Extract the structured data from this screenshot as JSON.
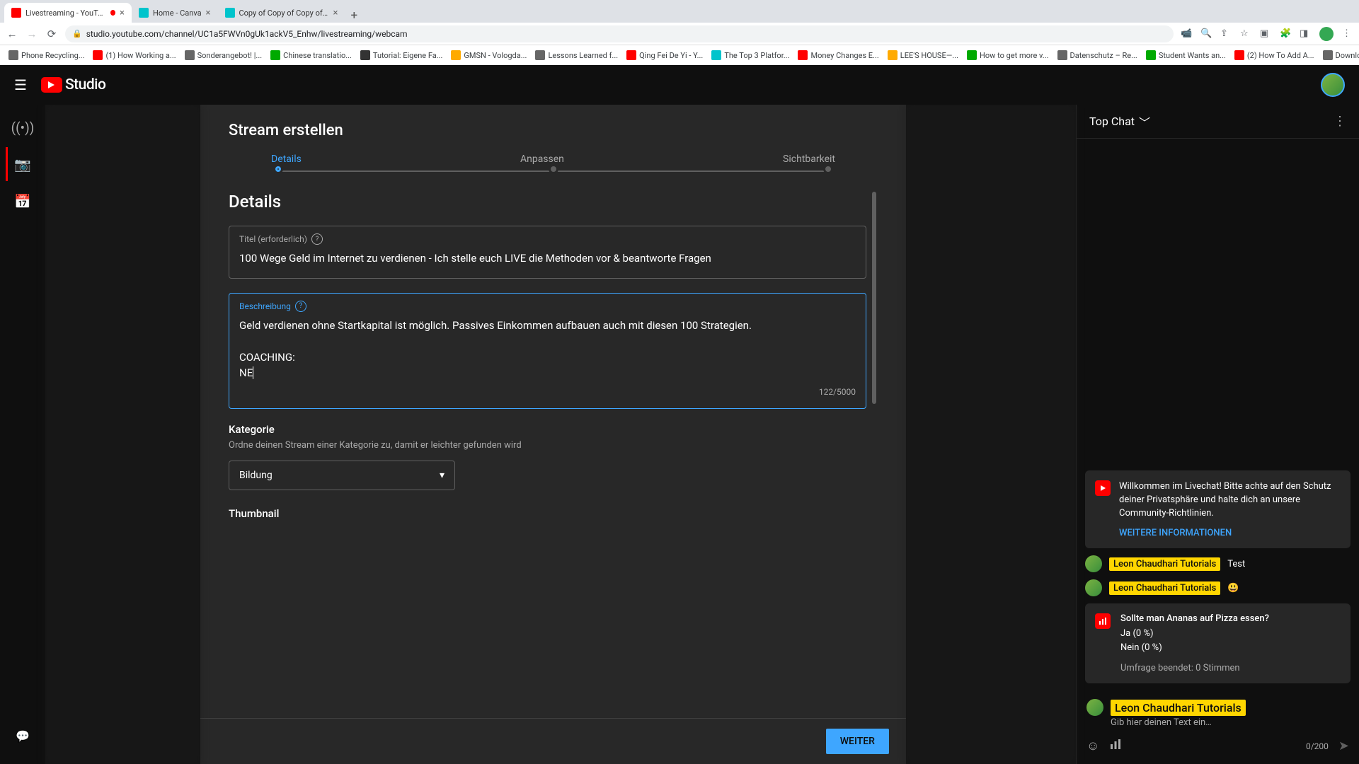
{
  "browser": {
    "tabs": [
      {
        "title": "Livestreaming - YouTube S",
        "active": true,
        "favicon": "#f00",
        "rec": true
      },
      {
        "title": "Home - Canva",
        "favicon": "#00c4cc"
      },
      {
        "title": "Copy of Copy of Copy of Cop",
        "favicon": "#00c4cc"
      }
    ],
    "url": "studio.youtube.com/channel/UC1a5FWVn0gUk1ackV5_Enhw/livestreaming/webcam",
    "bookmarks": [
      {
        "label": "Phone Recycling...",
        "color": "#666"
      },
      {
        "label": "(1) How Working a...",
        "color": "#f00"
      },
      {
        "label": "Sonderangebot! |...",
        "color": "#666"
      },
      {
        "label": "Chinese translatio...",
        "color": "#0a0"
      },
      {
        "label": "Tutorial: Eigene Fa...",
        "color": "#333"
      },
      {
        "label": "GMSN - Vologda...",
        "color": "#fa0"
      },
      {
        "label": "Lessons Learned f...",
        "color": "#666"
      },
      {
        "label": "Qing Fei De Yi - Y...",
        "color": "#f00"
      },
      {
        "label": "The Top 3 Platfor...",
        "color": "#00c4cc"
      },
      {
        "label": "Money Changes E...",
        "color": "#f00"
      },
      {
        "label": "LEE'S HOUSE—...",
        "color": "#fa0"
      },
      {
        "label": "How to get more v...",
        "color": "#0a0"
      },
      {
        "label": "Datenschutz – Re...",
        "color": "#666"
      },
      {
        "label": "Student Wants an...",
        "color": "#0a0"
      },
      {
        "label": "(2) How To Add A...",
        "color": "#f00"
      },
      {
        "label": "Download - Cooki...",
        "color": "#666"
      }
    ]
  },
  "header": {
    "studio": "Studio"
  },
  "modal": {
    "title": "Stream erstellen",
    "steps": {
      "s1": "Details",
      "s2": "Anpassen",
      "s3": "Sichtbarkeit"
    },
    "section": "Details",
    "titleField": {
      "label": "Titel (erforderlich)",
      "value": "100 Wege Geld im Internet zu verdienen - Ich stelle euch LIVE die Methoden vor & beantworte Fragen"
    },
    "descField": {
      "label": "Beschreibung",
      "value": "Geld verdienen ohne Startkapital ist möglich. Passives Einkommen aufbauen auch mit diesen 100 Strategien.\n\nCOACHING:\nNE",
      "count": "122/5000"
    },
    "kategorie": {
      "label": "Kategorie",
      "hint": "Ordne deinen Stream einer Kategorie zu, damit er leichter gefunden wird",
      "value": "Bildung"
    },
    "thumbnail": "Thumbnail",
    "next": "WEITER"
  },
  "chat": {
    "header": "Top Chat",
    "welcome": {
      "text": "Willkommen im Livechat! Bitte achte auf den Schutz deiner Privatsphäre und halte dich an unsere Community-Richtlinien.",
      "link": "WEITERE INFORMATIONEN"
    },
    "messages": [
      {
        "name": "Leon Chaudhari Tutorials",
        "text": "Test"
      },
      {
        "name": "Leon Chaudhari Tutorials",
        "text": "😃"
      }
    ],
    "poll": {
      "question": "Sollte man Ananas auf Pizza essen?",
      "opt1": "Ja (0 %)",
      "opt2": "Nein (0 %)",
      "ended": "Umfrage beendet: 0 Stimmen"
    },
    "inputUser": "Leon Chaudhari Tutorials",
    "inputPlaceholder": "Gib hier deinen Text ein…",
    "charCount": "0/200"
  }
}
